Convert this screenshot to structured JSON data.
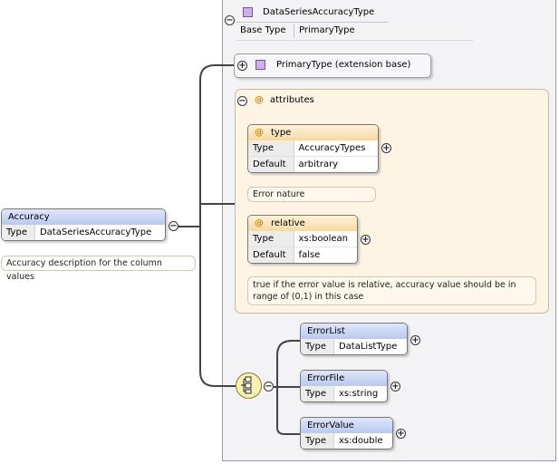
{
  "complex_type": {
    "name": "DataSeriesAccuracyType",
    "base_type_label": "Base Type",
    "base_type_value": "PrimaryType",
    "extension": "PrimaryType (extension base)"
  },
  "attributes": {
    "title": "attributes",
    "items": [
      {
        "name": "type",
        "rows": [
          {
            "key": "Type",
            "value": "AccuracyTypes"
          },
          {
            "key": "Default",
            "value": "arbitrary"
          }
        ],
        "doc": "Error nature"
      },
      {
        "name": "relative",
        "rows": [
          {
            "key": "Type",
            "value": "xs:boolean"
          },
          {
            "key": "Default",
            "value": "false"
          }
        ],
        "doc_line1": "true if the error value is relative, accuracy value should be in",
        "doc_line2": "range of (0,1) in this case"
      }
    ]
  },
  "element": {
    "name": "Accuracy",
    "type_label": "Type",
    "type_value": "DataSeriesAccuracyType",
    "doc": "Accuracy description for the column values"
  },
  "sequence": [
    {
      "name": "ErrorList",
      "type_label": "Type",
      "type_value": "DataListType"
    },
    {
      "name": "ErrorFile",
      "type_label": "Type",
      "type_value": "xs:string"
    },
    {
      "name": "ErrorValue",
      "type_label": "Type",
      "type_value": "xs:double"
    }
  ],
  "icons": {
    "collapse": "−",
    "expand": "+",
    "attribute": "@"
  },
  "colors": {
    "element_header": "#c5d3f2",
    "attribute_header": "#f6d9a3",
    "attribute_group": "#fdf4e3",
    "type_square": "#c9b3e6"
  }
}
